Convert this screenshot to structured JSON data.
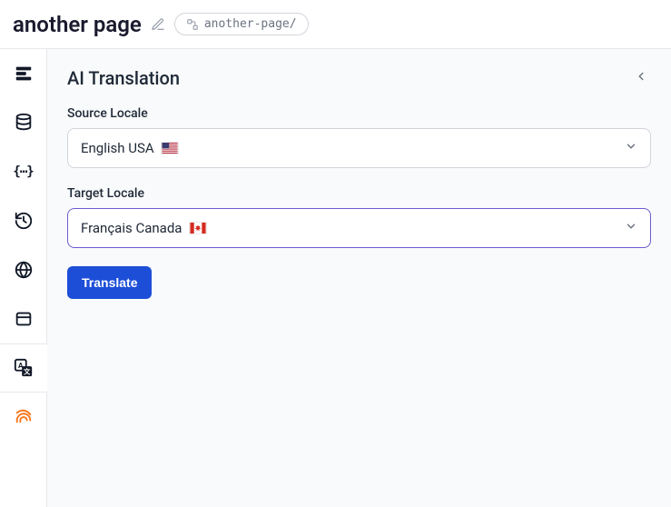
{
  "header": {
    "title": "another page",
    "slug": "another-page/"
  },
  "sidebar": {
    "items": [
      {
        "name": "blocks-icon"
      },
      {
        "name": "database-icon"
      },
      {
        "name": "json-icon",
        "label": "{⋯}"
      },
      {
        "name": "history-icon"
      },
      {
        "name": "globe-icon"
      },
      {
        "name": "window-icon"
      },
      {
        "name": "translate-icon"
      },
      {
        "name": "fingerprint-icon"
      }
    ]
  },
  "panel": {
    "title": "AI Translation",
    "source_label": "Source Locale",
    "source_value": "English USA",
    "source_flag": "us",
    "target_label": "Target Locale",
    "target_value": "Français Canada",
    "target_flag": "ca",
    "translate_label": "Translate"
  }
}
